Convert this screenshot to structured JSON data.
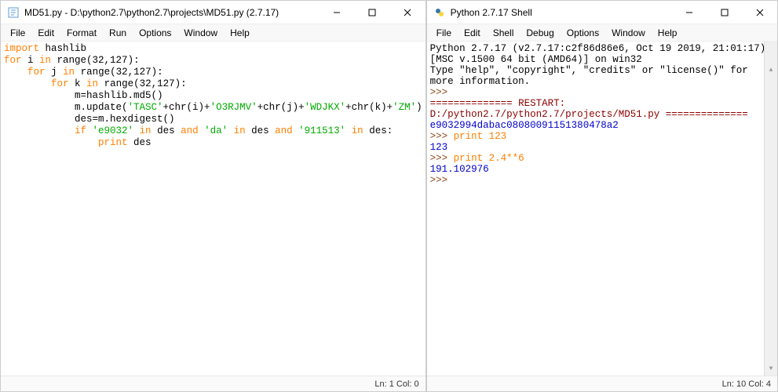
{
  "windows": {
    "editor": {
      "title": "MD51.py - D:\\python2.7\\python2.7\\projects\\MD51.py (2.7.17)",
      "menu": [
        "File",
        "Edit",
        "Format",
        "Run",
        "Options",
        "Window",
        "Help"
      ],
      "status": "Ln: 1  Col: 0",
      "code": {
        "l1_kw": "import",
        "l1_rest": " hashlib",
        "l2_kw1": "for",
        "l2_id": " i ",
        "l2_kw2": "in",
        "l2_rest": " range(32,127):",
        "l3_pad": "    ",
        "l3_kw1": "for",
        "l3_id": " j ",
        "l3_kw2": "in",
        "l3_rest": " range(32,127):",
        "l4_pad": "        ",
        "l4_kw1": "for",
        "l4_id": " k ",
        "l4_kw2": "in",
        "l4_rest": " range(32,127):",
        "l5_pad": "            ",
        "l5_rest": "m=hashlib.md5()",
        "l6_pad": "            ",
        "l6_a": "m.update(",
        "l6_s1": "'TASC'",
        "l6_b": "+chr(i)+",
        "l6_s2": "'O3RJMV'",
        "l6_c": "+chr(j)+",
        "l6_s3": "'WDJKX'",
        "l6_d": "+chr(k)+",
        "l6_s4": "'ZM'",
        "l6_e": ")",
        "l7_pad": "            ",
        "l7_rest": "des=m.hexdigest()",
        "l8_pad": "            ",
        "l8_kw1": "if ",
        "l8_s1": "'e9032'",
        "l8_kw2": " in ",
        "l8_id1": "des",
        "l8_kw3": " and ",
        "l8_s2": "'da'",
        "l8_kw4": " in ",
        "l8_id2": "des",
        "l8_kw5": " and ",
        "l8_s3": "'911513'",
        "l8_kw6": " in ",
        "l8_id3": "des:",
        "l9_pad": "                ",
        "l9_kw": "print ",
        "l9_rest": "des"
      }
    },
    "shell": {
      "title": "Python 2.7.17 Shell",
      "menu": [
        "File",
        "Edit",
        "Shell",
        "Debug",
        "Options",
        "Window",
        "Help"
      ],
      "status": "Ln: 10  Col: 4",
      "lines": {
        "banner1": "Python 2.7.17 (v2.7.17:c2f86d86e6, Oct 19 2019, 21:01:17) [MSC v.1500 64 bit (AMD64)] on win32",
        "banner2": "Type \"help\", \"copyright\", \"credits\" or \"license()\" for more information.",
        "p1": ">>> ",
        "restart": "============== RESTART: D:/python2.7/python2.7/projects/MD51.py ==============",
        "out1": "e9032994dabac08080091151380478a2",
        "p2": ">>> ",
        "cmd2": "print 123",
        "out2": "123",
        "p3": ">>> ",
        "cmd3": "print 2.4**6",
        "out3": "191.102976",
        "p4": ">>> "
      }
    }
  },
  "scrollbar": {
    "up": "▲",
    "down": "▼"
  }
}
